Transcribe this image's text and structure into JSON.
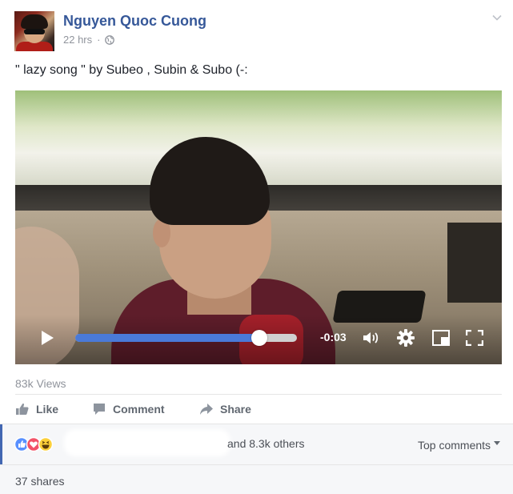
{
  "post": {
    "author": "Nguyen Quoc Cuong",
    "timestamp": "22 hrs",
    "privacy_icon": "globe-icon",
    "caption": "\" lazy song \" by Subeo , Subin & Subo (-:"
  },
  "video": {
    "time_remaining": "-0:03",
    "progress": 0.83
  },
  "stats": {
    "views": "83k Views"
  },
  "actions": {
    "like": "Like",
    "comment": "Comment",
    "share": "Share"
  },
  "reactions": {
    "others": "and 8.3k others",
    "sort": "Top comments"
  },
  "shares": "37 shares",
  "colors": {
    "name_blue": "#365899",
    "progress_blue": "#4a7ad8",
    "meta_gray": "#90949c"
  }
}
